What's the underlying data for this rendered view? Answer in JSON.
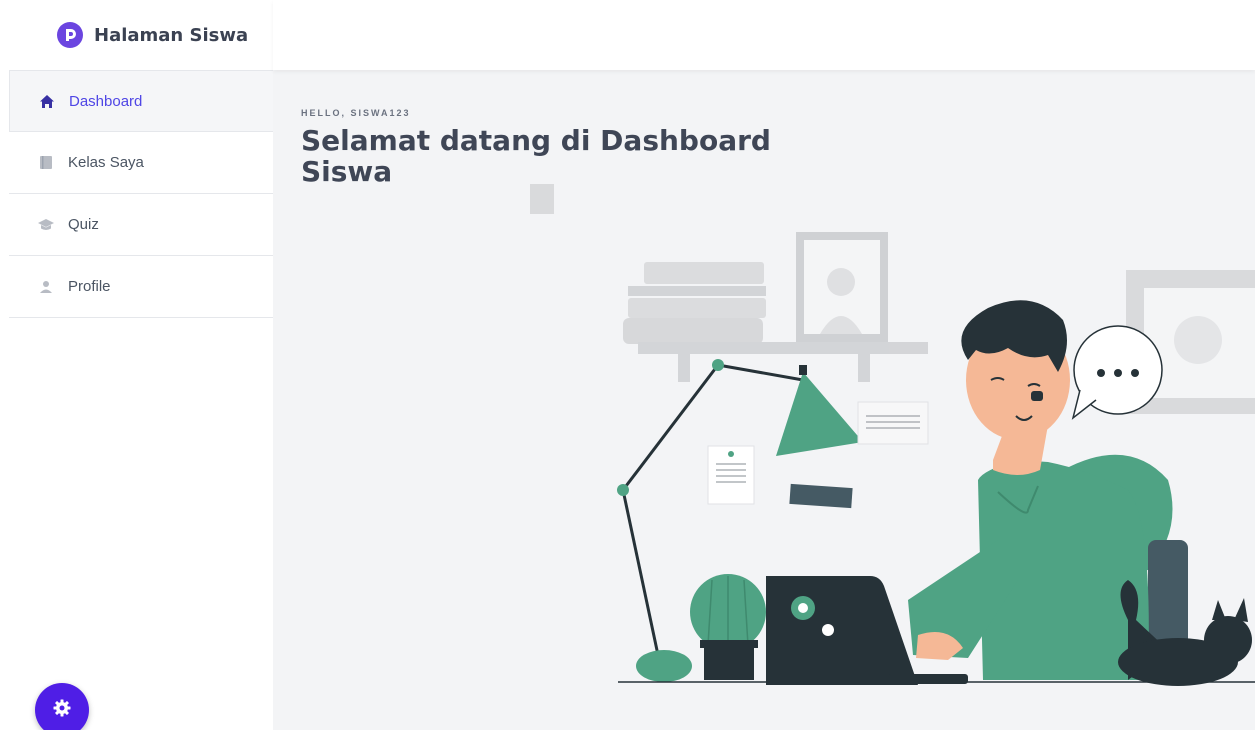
{
  "app": {
    "title": "Halaman Siswa"
  },
  "sidebar": {
    "items": [
      {
        "label": "Dashboard",
        "icon": "home-icon",
        "active": true
      },
      {
        "label": "Kelas Saya",
        "icon": "book-icon",
        "active": false
      },
      {
        "label": "Quiz",
        "icon": "graduation-cap-icon",
        "active": false
      },
      {
        "label": "Profile",
        "icon": "user-icon",
        "active": false
      }
    ]
  },
  "settings_button": {
    "icon": "gear-icon"
  },
  "main": {
    "greeting": "HELLO, SISWA123",
    "welcome_title": "Selamat datang di Dashboard Siswa"
  },
  "colors": {
    "accent": "#4f46e5",
    "brand": "#6b45e0",
    "illustration_green": "#4fa384"
  }
}
